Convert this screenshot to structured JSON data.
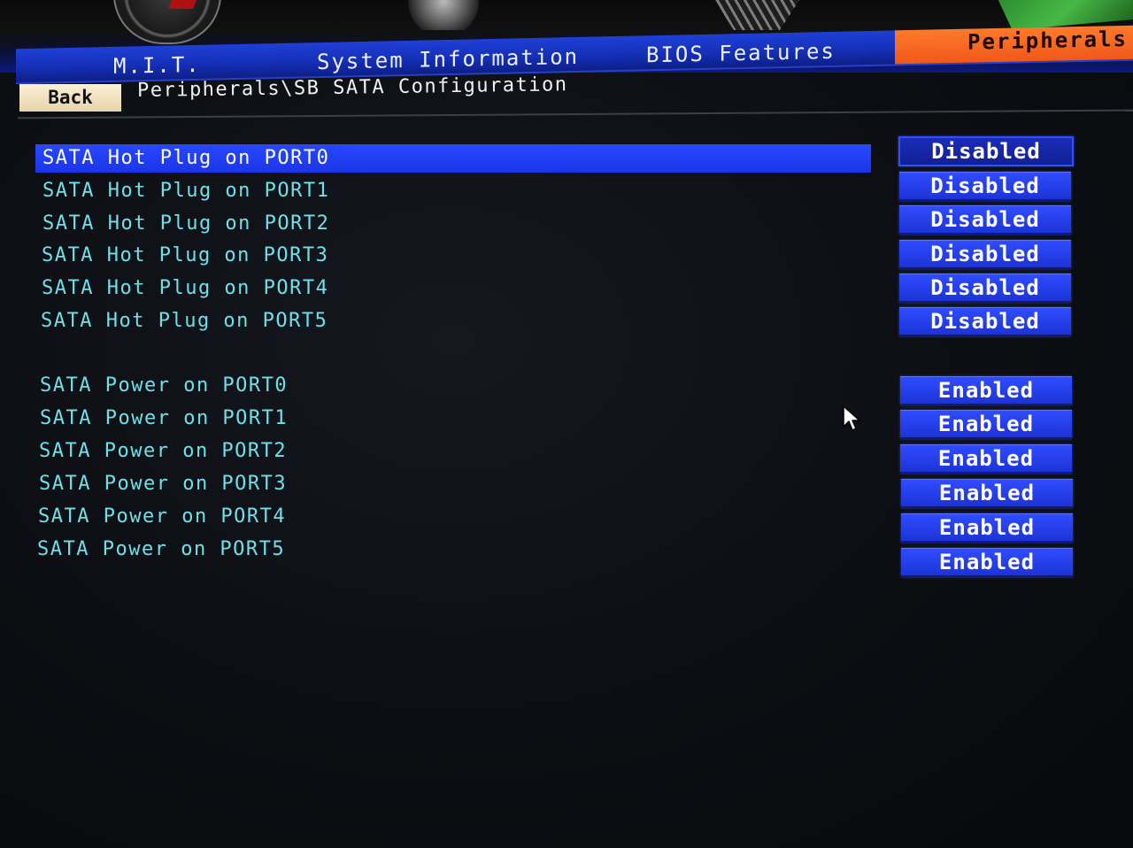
{
  "tabs": {
    "mit": "M.I.T.",
    "system_information": "System Information",
    "bios_features": "BIOS Features",
    "peripherals": "Peripherals"
  },
  "navigation": {
    "back_label": "Back",
    "breadcrumb": "Peripherals\\SB SATA Configuration"
  },
  "settings": {
    "hot_plug": [
      {
        "label": "SATA Hot Plug on PORT0",
        "value": "Disabled",
        "selected": true
      },
      {
        "label": "SATA Hot Plug on PORT1",
        "value": "Disabled"
      },
      {
        "label": "SATA Hot Plug on PORT2",
        "value": "Disabled"
      },
      {
        "label": "SATA Hot Plug on PORT3",
        "value": "Disabled"
      },
      {
        "label": "SATA Hot Plug on PORT4",
        "value": "Disabled"
      },
      {
        "label": "SATA Hot Plug on PORT5",
        "value": "Disabled"
      }
    ],
    "power": [
      {
        "label": "SATA Power on PORT0",
        "value": "Enabled"
      },
      {
        "label": "SATA Power on PORT1",
        "value": "Enabled"
      },
      {
        "label": "SATA Power on PORT2",
        "value": "Enabled"
      },
      {
        "label": "SATA Power on PORT3",
        "value": "Enabled"
      },
      {
        "label": "SATA Power on PORT4",
        "value": "Enabled"
      },
      {
        "label": "SATA Power on PORT5",
        "value": "Enabled"
      }
    ]
  },
  "colors": {
    "accent_tab": "#f0581a",
    "selection": "#1b34e8",
    "label_text": "#6fe0e8"
  },
  "icons": [
    "speedometer-icon",
    "gear-icon",
    "chip-icon",
    "motherboard-icon",
    "mouse-pointer-icon"
  ]
}
